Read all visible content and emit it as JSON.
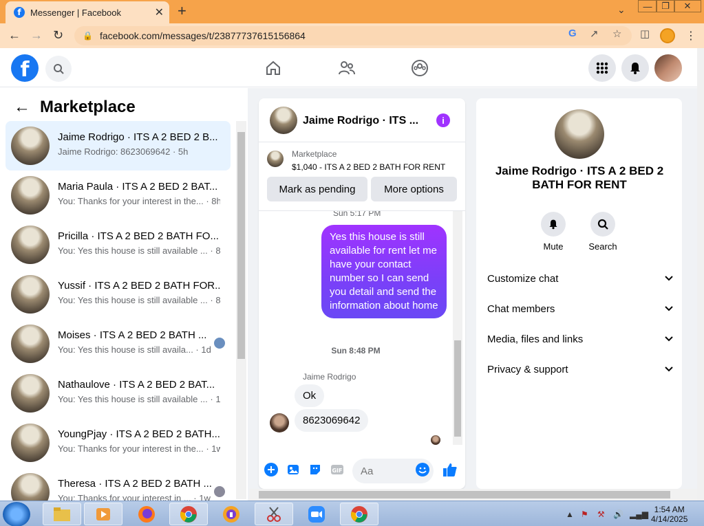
{
  "browser": {
    "tab_title": "Messenger | Facebook",
    "tab_close": "✕",
    "new_tab": "+",
    "url": "facebook.com/messages/t/23877737615156864",
    "win_min": "—",
    "win_max": "❐",
    "win_close": "✕"
  },
  "left": {
    "title": "Marketplace",
    "back_glyph": "←",
    "conversations": [
      {
        "name": "Jaime Rodrigo · ITS A 2 BED 2 B...",
        "preview": "Jaime Rodrigo: 8623069642 · 5h"
      },
      {
        "name": "Maria Paula · ITS A 2 BED 2 BAT...",
        "preview": "You: Thanks for your interest in the... · 8h"
      },
      {
        "name": "Pricilla · ITS A 2 BED 2 BATH FO...",
        "preview": "You: Yes this house is still available ... · 8h"
      },
      {
        "name": "Yussif · ITS A 2 BED 2 BATH FOR...",
        "preview": "You: Yes this house is still available ... · 8h"
      },
      {
        "name": "Moises · ITS A 2 BED 2 BATH ...",
        "preview": "You: Yes this house is still availa... · 1d"
      },
      {
        "name": "Nathaulove · ITS A 2 BED 2 BAT...",
        "preview": "You: Yes this house is still available ... · 1d"
      },
      {
        "name": "YoungPjay · ITS A 2 BED 2 BATH...",
        "preview": "You: Thanks for your interest in the... · 1w"
      },
      {
        "name": "Theresa · ITS A 2 BED 2 BATH ...",
        "preview": "You: Thanks for your interest in ... · 1w"
      }
    ]
  },
  "chat": {
    "title": "Jaime Rodrigo · ITS ...",
    "info_glyph": "i",
    "marketplace_label": "Marketplace",
    "listing": "$1,040 - ITS A 2 BED 2 BATH FOR RENT",
    "mark_pending": "Mark as pending",
    "more_options": "More options",
    "cut_timestamp": "Sun 5:17 PM",
    "outgoing_message": "Yes this house is still available for rent let me have your contact number so I can send you detail and send the information about home",
    "timestamp": "Sun 8:48 PM",
    "sender_name": "Jaime Rodrigo",
    "incoming": [
      "Ok",
      "8623069642"
    ],
    "composer_placeholder": "Aa"
  },
  "right": {
    "title": "Jaime Rodrigo · ITS A 2 BED 2 BATH FOR RENT",
    "actions": [
      {
        "label": "Mute",
        "icon": "bell-icon"
      },
      {
        "label": "Search",
        "icon": "search-icon"
      }
    ],
    "sections": [
      "Customize chat",
      "Chat members",
      "Media, files and links",
      "Privacy & support"
    ],
    "chevron": "⌄"
  },
  "taskbar": {
    "time": "1:54 AM",
    "date": "4/14/2025"
  },
  "colors": {
    "fb_blue": "#1877f2",
    "accent_purple": "#a033ff",
    "chrome_orange": "#f6a34a"
  }
}
